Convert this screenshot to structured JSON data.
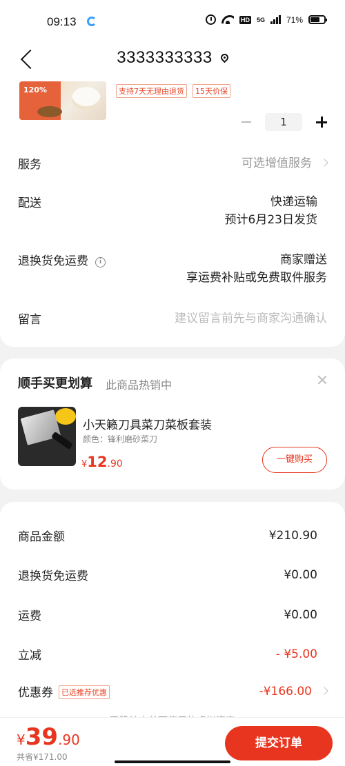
{
  "status_bar": {
    "time": "09:13",
    "battery": "71%",
    "network": "5G",
    "battery_level": 0.71
  },
  "header": {
    "title": "3333333333"
  },
  "product": {
    "tags": [
      "支持7天无理由退货",
      "15天价保"
    ],
    "quantity": "1"
  },
  "rows": {
    "service": {
      "label": "服务",
      "value": "可选增值服务"
    },
    "delivery": {
      "label": "配送",
      "value_line1": "快递运输",
      "value_line2": "预计6月23日发货"
    },
    "return_shipping": {
      "label": "退换货免运费",
      "value_line1": "商家赠送",
      "value_line2": "享运费补贴或免费取件服务"
    },
    "message": {
      "label": "留言",
      "placeholder": "建议留言前先与商家沟通确认"
    }
  },
  "upsell": {
    "title": "顺手买更划算",
    "subtitle": "此商品热销中",
    "product_name": "小天籁刀具菜刀菜板套装",
    "spec": "颜色：锋利磨砂菜刀",
    "price_currency": "¥",
    "price_int": "12",
    "price_dec": ".90",
    "buy_label": "一键购买"
  },
  "summary": {
    "goods_amount": {
      "label": "商品金额",
      "value": "¥210.90"
    },
    "return_fee": {
      "label": "退换货免运费",
      "value": "¥0.00"
    },
    "shipping": {
      "label": "运费",
      "value": "¥0.00"
    },
    "discount": {
      "label": "立减",
      "value": "- ¥5.00"
    },
    "coupon": {
      "label": "优惠券",
      "tag": "已选推荐优惠",
      "value": "-¥166.00"
    },
    "note": "已确认本单可使用的虚拟资产"
  },
  "bottom": {
    "currency": "¥",
    "total_int": "39",
    "total_dec": ".90",
    "saved": "共省¥171.00",
    "submit_label": "提交订单"
  },
  "colors": {
    "accent": "#e8351f",
    "tag_border": "#f0a28c"
  }
}
